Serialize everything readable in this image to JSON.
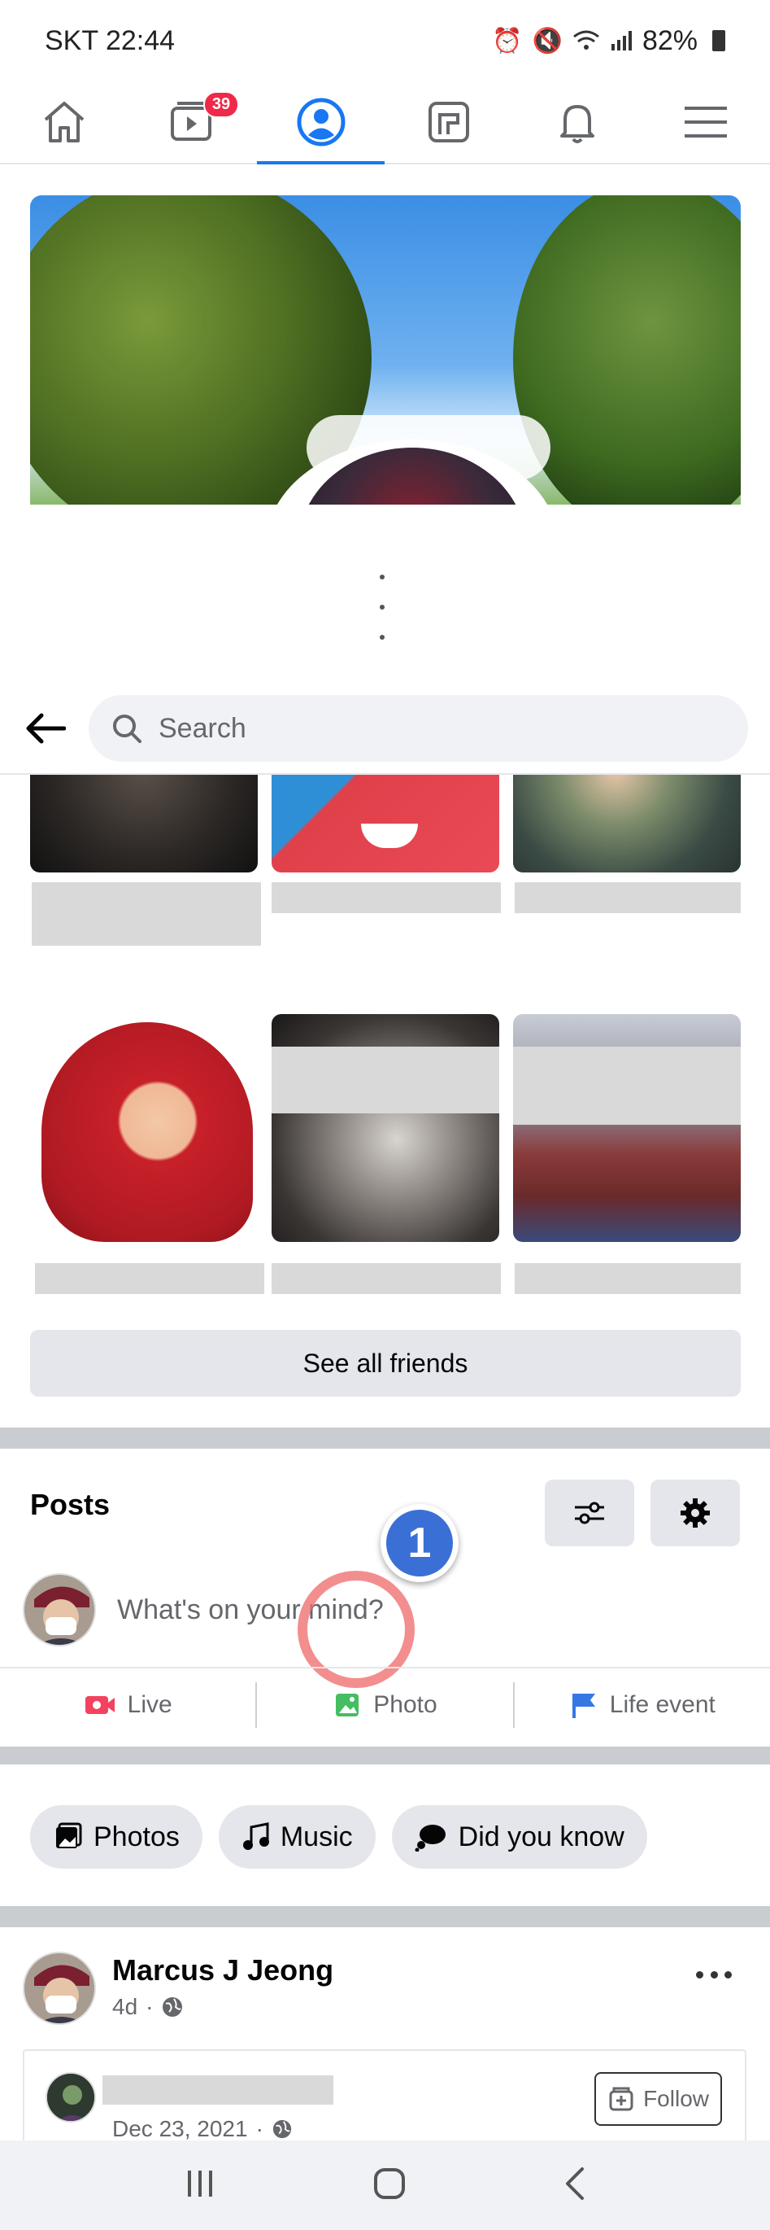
{
  "status_bar": {
    "time": "SKT 22:44",
    "battery": "82%"
  },
  "nav": {
    "watch_badge": "39"
  },
  "search": {
    "placeholder": "Search"
  },
  "friends": {
    "see_all_label": "See all friends"
  },
  "posts": {
    "title": "Posts",
    "composer_prompt": "What's on your mind?",
    "actions": [
      "Live",
      "Photo",
      "Life event"
    ]
  },
  "annotation": {
    "step_number": "1"
  },
  "chips": [
    "Photos",
    "Music",
    "Did you know"
  ],
  "post": {
    "author": "Marcus J Jeong",
    "age": "4d",
    "shared_date": "Dec 23, 2021",
    "follow_label": "Follow"
  },
  "colors": {
    "accent": "#1877f2",
    "badge": "#f02849",
    "live": "#f3425f",
    "photo": "#45bd62",
    "life_event": "#3578e5",
    "step_badge": "#3a6fd6"
  }
}
